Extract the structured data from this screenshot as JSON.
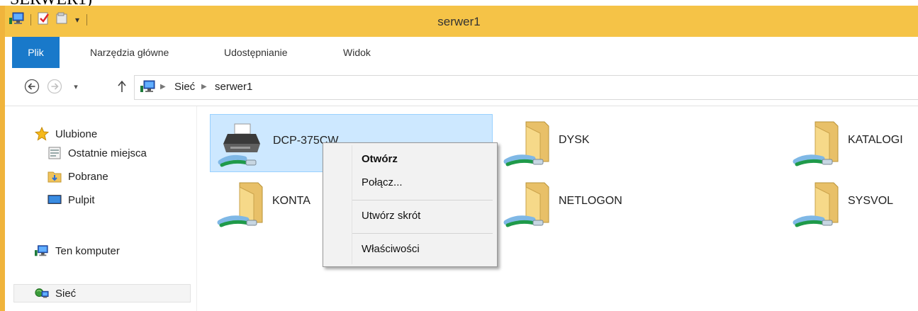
{
  "document_caption": "SERWER1)",
  "window": {
    "title": "serwer1"
  },
  "ribbon": {
    "tabs": [
      {
        "label": "Plik"
      },
      {
        "label": "Narzędzia główne"
      },
      {
        "label": "Udostępnianie"
      },
      {
        "label": "Widok"
      }
    ]
  },
  "address_bar": {
    "breadcrumb": [
      "Sieć",
      "serwer1"
    ]
  },
  "sidebar": {
    "favorites_label": "Ulubione",
    "favorites": [
      {
        "label": "Ostatnie miejsca",
        "icon": "recent-places-icon"
      },
      {
        "label": "Pobrane",
        "icon": "downloads-folder-icon"
      },
      {
        "label": "Pulpit",
        "icon": "desktop-icon"
      }
    ],
    "this_pc_label": "Ten komputer",
    "network_label": "Sieć"
  },
  "items": [
    {
      "label": "DCP-375CW",
      "icon": "shared-printer-icon",
      "selected": true
    },
    {
      "label": "DYSK",
      "icon": "shared-folder-icon"
    },
    {
      "label": "KATALOGI",
      "icon": "shared-folder-icon"
    },
    {
      "label": "KONTA",
      "icon": "shared-folder-icon"
    },
    {
      "label": "NETLOGON",
      "icon": "shared-folder-icon"
    },
    {
      "label": "SYSVOL",
      "icon": "shared-folder-icon"
    }
  ],
  "context_menu": {
    "items": [
      {
        "label": "Otwórz",
        "bold": true
      },
      {
        "label": "Połącz..."
      },
      {
        "label": "Utwórz skrót"
      },
      {
        "label": "Właściwości"
      }
    ]
  },
  "colors": {
    "title_bar": "#f5c347",
    "file_tab": "#1979ca",
    "selection": "#cde8ff",
    "selection_border": "#99d1ff"
  }
}
